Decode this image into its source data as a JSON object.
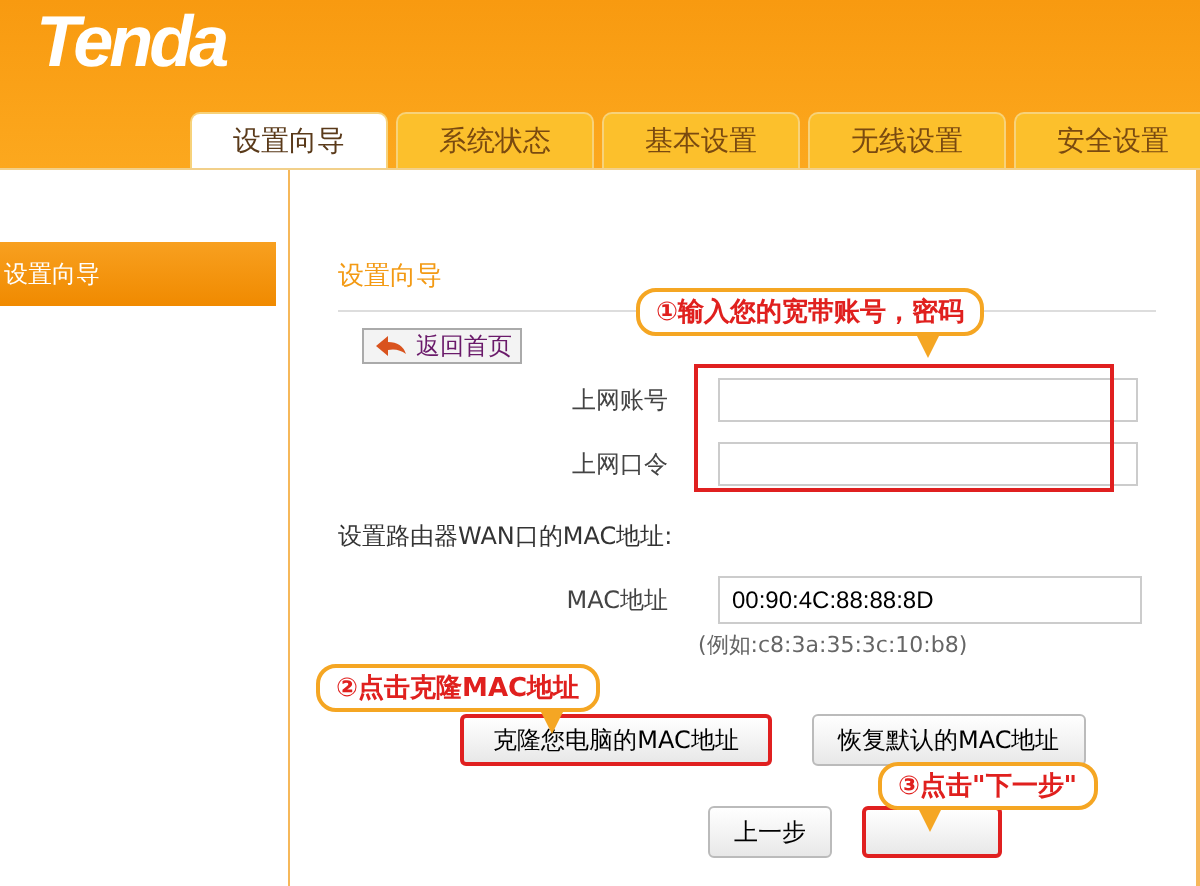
{
  "logo": "Tenda",
  "tabs": [
    {
      "label": "设置向导",
      "selected": true
    },
    {
      "label": "系统状态",
      "selected": false
    },
    {
      "label": "基本设置",
      "selected": false
    },
    {
      "label": "无线设置",
      "selected": false
    },
    {
      "label": "安全设置",
      "selected": false
    }
  ],
  "sidebar": {
    "items": [
      {
        "label": "设置向导",
        "selected": true
      }
    ]
  },
  "panel": {
    "title": "设置向导",
    "back_button": "返回首页",
    "fields": [
      {
        "label": "上网账号"
      },
      {
        "label": "上网口令"
      }
    ],
    "mac_heading": "设置路由器WAN口的MAC地址:",
    "mac_label": "MAC地址",
    "mac_value": "00:90:4C:88:88:8D",
    "mac_hint": "(例如:c8:3a:35:3c:10:b8)",
    "clone_button": "克隆您电脑的MAC地址",
    "restore_button": "恢复默认的MAC地址",
    "prev_button": "上一步"
  },
  "callouts": [
    "①输入您的宽带账号，密码",
    "②点击克隆MAC地址",
    "③点击\"下一步\""
  ]
}
